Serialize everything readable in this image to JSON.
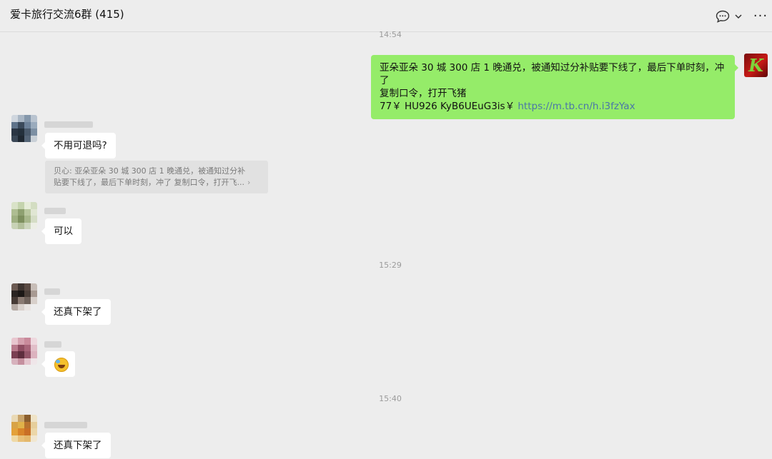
{
  "header": {
    "title": "爱卡旅行交流6群 (415)",
    "more_label": "···"
  },
  "timestamps": [
    "14:54",
    "15:29",
    "15:40"
  ],
  "messages": {
    "self_msg": {
      "line1": "亚朵亚朵 30 城 300 店 1 晚通兑，被通知过分补贴要下线了，最后下单时刻，冲了",
      "line2": "复制口令，打开飞猪",
      "line3_text": "77￥ HU926 KyB6UEuG3is￥ ",
      "line3_link": "https://m.tb.cn/h.i3fzYax"
    },
    "reply1": {
      "text": "不用可退吗?",
      "quote_line1": "贝心: 亚朵亚朵 30 城 300 店 1 晚通兑，被通知过分补",
      "quote_line2": "贴要下线了，最后下单时刻，冲了 复制口令，打开飞...",
      "quote_arrow": "›"
    },
    "reply2": {
      "text": "可以"
    },
    "reply3": {
      "text": "还真下架了"
    },
    "reply5": {
      "text": "还真下架了"
    }
  },
  "icons": {
    "chat": "chat-bubble-icon",
    "chevron": "chevron-down-icon",
    "more": "more-icon",
    "self_avatar_letter": "K"
  },
  "colors": {
    "background": "#ededed",
    "self_bubble": "#95ec69",
    "other_bubble": "#ffffff",
    "link": "#4a76a8"
  }
}
